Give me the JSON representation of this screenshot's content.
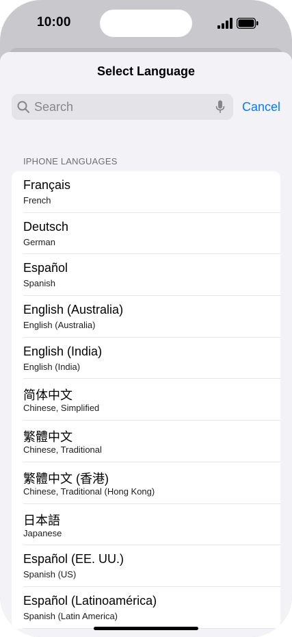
{
  "status_bar": {
    "time": "10:00",
    "signal_icon": "cellular-signal-icon",
    "battery_icon": "battery-full-icon"
  },
  "sheet": {
    "title": "Select Language",
    "search": {
      "placeholder": "Search",
      "value": "",
      "search_icon": "magnifier-icon",
      "mic_icon": "microphone-icon"
    },
    "cancel_label": "Cancel",
    "section_header": "IPHONE LANGUAGES",
    "languages": [
      {
        "native": "Français",
        "english": "French"
      },
      {
        "native": "Deutsch",
        "english": "German"
      },
      {
        "native": "Español",
        "english": "Spanish"
      },
      {
        "native": "English (Australia)",
        "english": "English (Australia)"
      },
      {
        "native": "English (India)",
        "english": "English (India)"
      },
      {
        "native": "简体中文",
        "english": "Chinese, Simplified"
      },
      {
        "native": "繁體中文",
        "english": "Chinese, Traditional"
      },
      {
        "native": "繁體中文 (香港)",
        "english": "Chinese, Traditional (Hong Kong)"
      },
      {
        "native": "日本語",
        "english": "Japanese"
      },
      {
        "native": "Español (EE. UU.)",
        "english": "Spanish (US)"
      },
      {
        "native": "Español (Latinoamérica)",
        "english": "Spanish (Latin America)"
      }
    ]
  },
  "colors": {
    "accent": "#0a7aff",
    "sheet_background": "#f2f2f7",
    "search_background": "#e3e3e8",
    "secondary_text": "#6d6d72"
  }
}
